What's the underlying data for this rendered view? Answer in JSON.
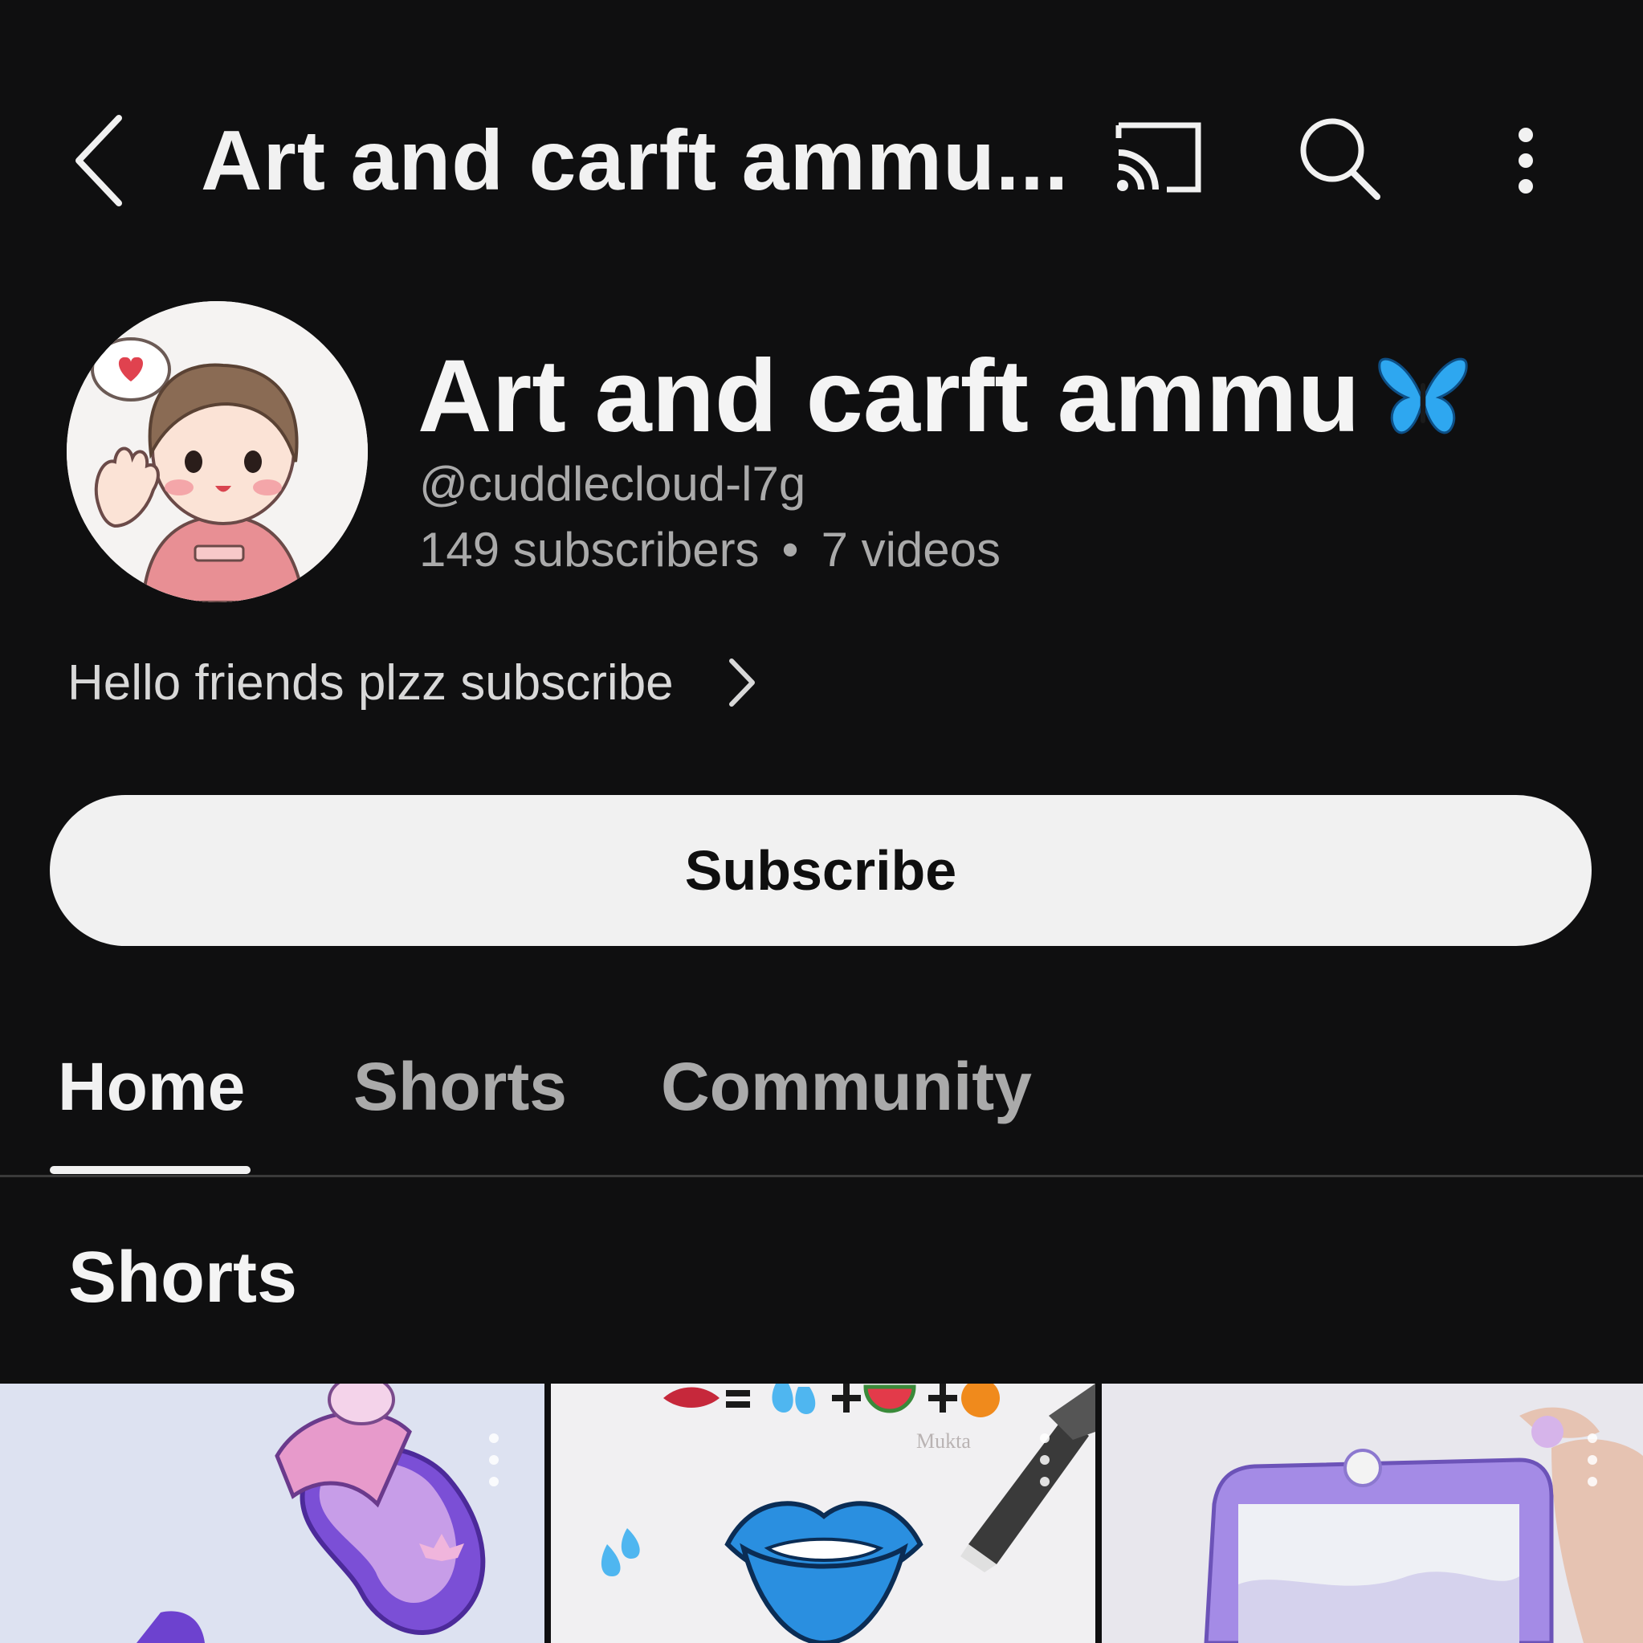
{
  "header": {
    "title": "Art and carft ammu...",
    "icons": [
      "back-arrow-icon",
      "cast-icon",
      "search-icon",
      "more-vert-icon"
    ]
  },
  "channel": {
    "name": "Art and carft ammu",
    "name_emoji_icon": "butterfly-icon",
    "handle": "@cuddlecloud-l7g",
    "subscribers": "149 subscribers",
    "separator": "•",
    "videos": "7 videos",
    "description": "Hello friends plzz subscribe"
  },
  "subscribe_button": {
    "label": "Subscribe"
  },
  "tabs": [
    {
      "label": "Home",
      "selected": true
    },
    {
      "label": "Shorts",
      "selected": false
    },
    {
      "label": "Community",
      "selected": false
    }
  ],
  "section": {
    "title": "Shorts"
  },
  "shorts": [
    {
      "thumbnail": "purple-paper-slipper",
      "menu_icon": "more-vert-icon"
    },
    {
      "thumbnail": "blue-lips-drawing",
      "overlay_text": "Mukta",
      "menu_icon": "more-vert-icon"
    },
    {
      "thumbnail": "purple-craft-frame",
      "menu_icon": "more-vert-icon"
    }
  ],
  "colors": {
    "background": "#0f0f10",
    "primary_text": "#f1f1f1",
    "secondary_text": "#aaaaaa",
    "subscribe_bg": "#f1f1f1",
    "subscribe_text": "#0f0f0f",
    "butterfly": "#2ea7f0"
  }
}
